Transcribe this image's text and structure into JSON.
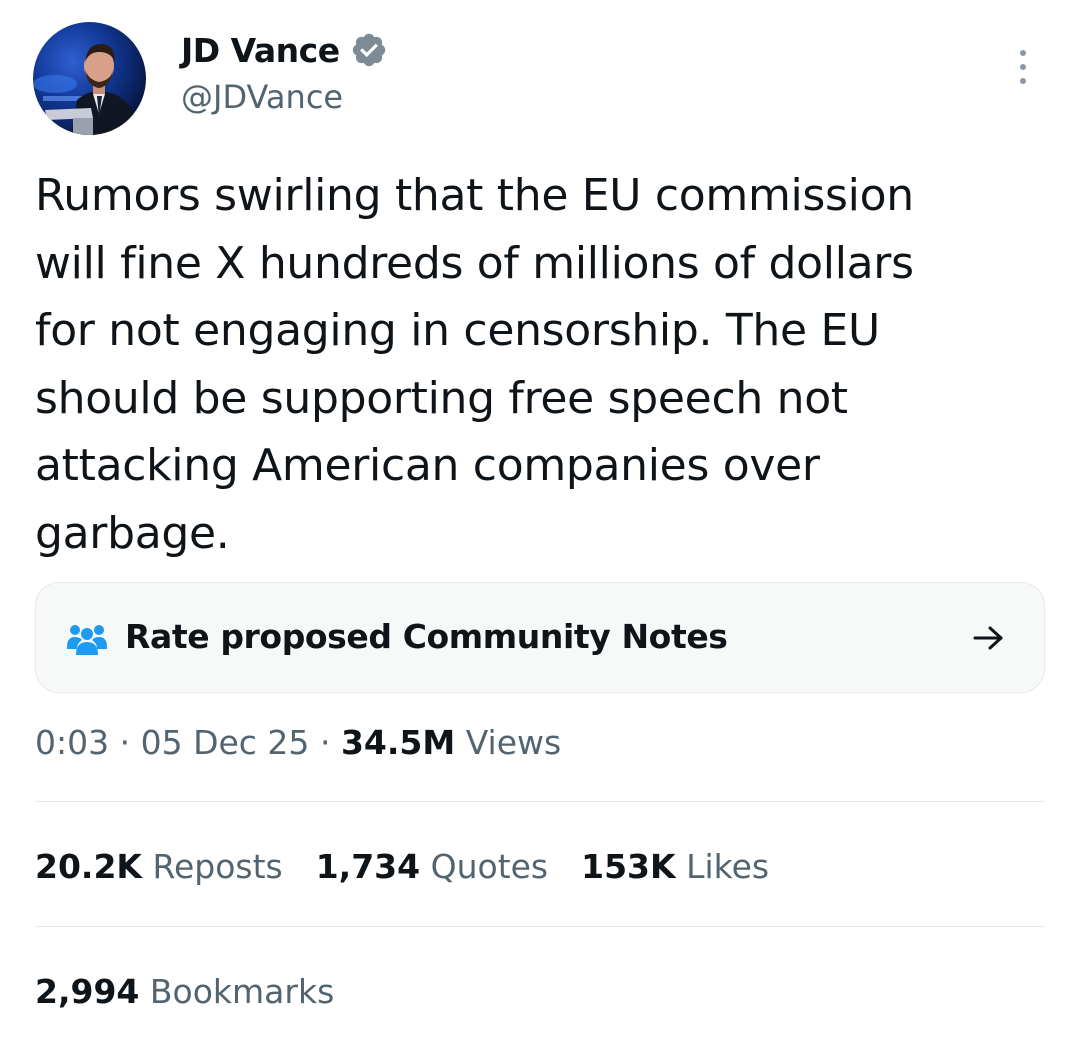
{
  "author": {
    "display_name": "JD Vance",
    "handle": "@JDVance",
    "verified": true
  },
  "tweet": {
    "text": "Rumors swirling that the EU commission\nwill fine X hundreds of millions of dollars\nfor not engaging in censorship. The EU\nshould be supporting free speech not\nattacking American companies over\ngarbage."
  },
  "community_notes": {
    "label": "Rate proposed Community Notes",
    "icon": "people-icon",
    "arrow": "arrow-right-icon"
  },
  "meta": {
    "time": "0:03",
    "separator": "·",
    "date": "05 Dec 25",
    "views_count": "34.5M",
    "views_label": "Views"
  },
  "stats": {
    "reposts_count": "20.2K",
    "reposts_label": "Reposts",
    "quotes_count": "1,734",
    "quotes_label": "Quotes",
    "likes_count": "153K",
    "likes_label": "Likes",
    "bookmarks_count": "2,994",
    "bookmarks_label": "Bookmarks"
  },
  "colors": {
    "text_primary": "#0f1419",
    "text_secondary": "#536471",
    "verified_badge": "#7d8b97",
    "notes_icon": "#1d9bf0",
    "notes_background": "#f7f9f9",
    "divider": "#e3e7ea"
  }
}
